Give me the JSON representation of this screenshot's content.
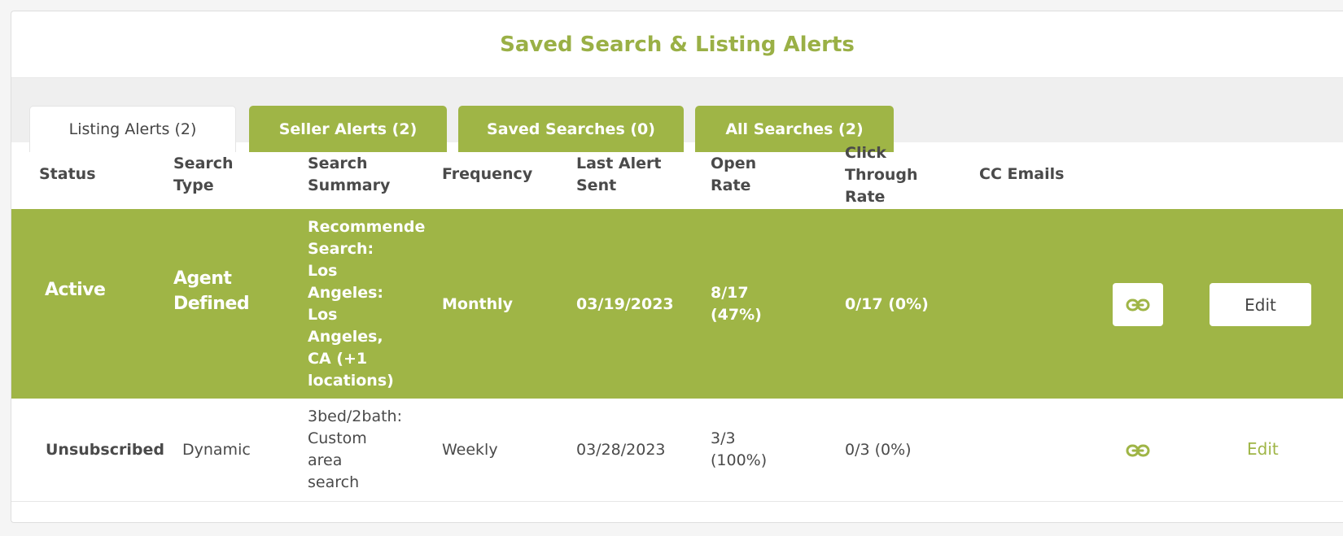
{
  "title": "Saved Search & Listing Alerts",
  "tabs": [
    {
      "label": "Listing Alerts (2)",
      "active": true
    },
    {
      "label": "Seller Alerts (2)",
      "active": false
    },
    {
      "label": "Saved Searches (0)",
      "active": false
    },
    {
      "label": "All Searches (2)",
      "active": false
    }
  ],
  "columns": {
    "status": [
      "Status"
    ],
    "search_type": [
      "Search",
      "Type"
    ],
    "search_summary": [
      "Search",
      "Summary"
    ],
    "frequency": [
      "Frequency"
    ],
    "last_alert_sent": [
      "Last Alert",
      "Sent"
    ],
    "open_rate": [
      "Open",
      "Rate"
    ],
    "click_through_rate": [
      "Click",
      "Through",
      "Rate"
    ],
    "cc_emails": [
      "CC Emails"
    ]
  },
  "rows": [
    {
      "status": "Active",
      "search_type": [
        "Agent",
        "Defined"
      ],
      "search_summary": [
        "Recommende",
        "Search:",
        "Los",
        "Angeles:",
        "Los",
        "Angeles,",
        "CA (+1",
        "locations)"
      ],
      "frequency": "Monthly",
      "last_alert_sent": "03/19/2023",
      "open_rate": [
        "8/17",
        "(47%)"
      ],
      "click_through_rate": "0/17 (0%)",
      "cc_emails": "",
      "link_icon": "link-icon",
      "edit_label": "Edit"
    },
    {
      "status": "Unsubscribed",
      "search_type": [
        "Dynamic"
      ],
      "search_summary": [
        "3bed/2bath:",
        "Custom",
        "area",
        "search"
      ],
      "frequency": "Weekly",
      "last_alert_sent": "03/28/2023",
      "open_rate": [
        "3/3",
        "(100%)"
      ],
      "click_through_rate": "0/3 (0%)",
      "cc_emails": "",
      "link_icon": "link-icon",
      "edit_label": "Edit"
    }
  ],
  "colors": {
    "accent": "#9fb546",
    "title": "#9ab046",
    "text": "#4a4a4a",
    "background": "#f5f5f5"
  }
}
